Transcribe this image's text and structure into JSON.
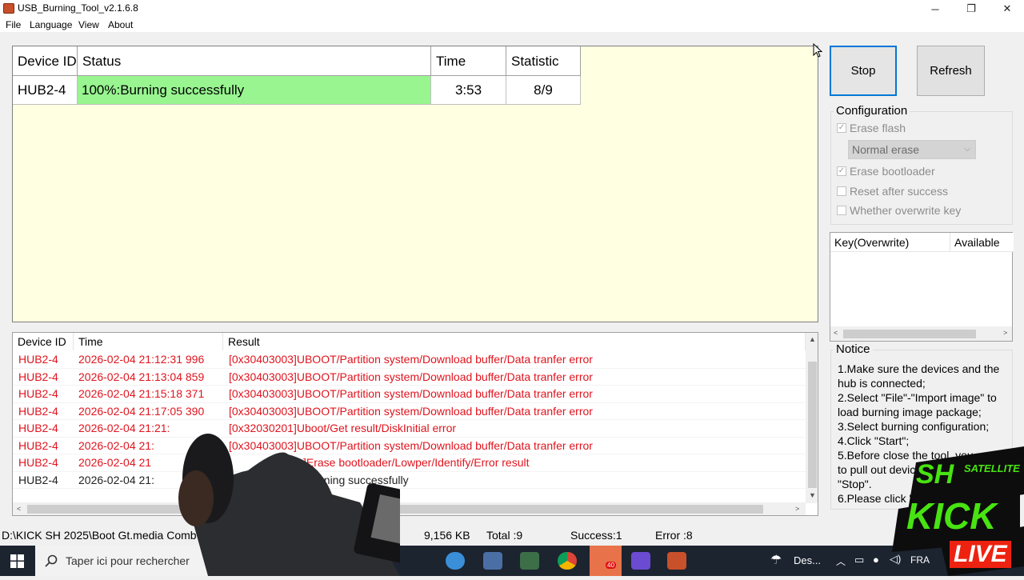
{
  "window": {
    "title": "USB_Burning_Tool_v2.1.6.8",
    "controls": {
      "minimize": "─",
      "maximize": "❐",
      "close": "✕"
    }
  },
  "menu": [
    "File",
    "Language",
    "View",
    "About"
  ],
  "device_grid": {
    "columns": [
      "Device ID",
      "Status",
      "Time",
      "Statistic"
    ],
    "rows": [
      {
        "device": "HUB2-4",
        "status": "100%:Burning successfully",
        "time": "3:53",
        "statistic": "8/9"
      }
    ],
    "status_color": "#98f590",
    "background": "#ffffe1"
  },
  "buttons": {
    "stop": "Stop",
    "refresh": "Refresh"
  },
  "configuration": {
    "title": "Configuration",
    "erase_flash": {
      "label": "Erase flash",
      "checked": true
    },
    "erase_mode": "Normal erase",
    "erase_bootloader": {
      "label": "Erase bootloader",
      "checked": true
    },
    "reset_after_success": {
      "label": "Reset after success",
      "checked": false
    },
    "overwrite_key": {
      "label": "Whether overwrite key",
      "checked": false
    }
  },
  "key_table": {
    "columns": [
      "Key(Overwrite)",
      "Available"
    ]
  },
  "notice": {
    "title": "Notice",
    "lines": [
      "1.Make sure the devices and the hub is connected;",
      "2.Select \"File\"-\"Import image\" to load burning image package;",
      "3.Select burning configuration;",
      "4.Click \"Start\";",
      "5.Before close the tool, you need to pull out devices first and click \"Stop\".",
      "6.Please click \"Stop\" before you"
    ]
  },
  "log": {
    "columns": [
      "Device ID",
      "Time",
      "Result"
    ],
    "rows": [
      {
        "device": "HUB2-4",
        "time": "2026-02-04 21:12:31 996",
        "result": "[0x30403003]UBOOT/Partition system/Download buffer/Data tranfer error",
        "kind": "err"
      },
      {
        "device": "HUB2-4",
        "time": "2026-02-04 21:13:04 859",
        "result": "[0x30403003]UBOOT/Partition system/Download buffer/Data tranfer error",
        "kind": "err"
      },
      {
        "device": "HUB2-4",
        "time": "2026-02-04 21:15:18 371",
        "result": "[0x30403003]UBOOT/Partition system/Download buffer/Data tranfer error",
        "kind": "err"
      },
      {
        "device": "HUB2-4",
        "time": "2026-02-04 21:17:05 390",
        "result": "[0x30403003]UBOOT/Partition system/Download buffer/Data tranfer error",
        "kind": "err"
      },
      {
        "device": "HUB2-4",
        "time": "2026-02-04 21:21:",
        "result": "[0x32030201]Uboot/Get result/DiskInitial error",
        "kind": "err"
      },
      {
        "device": "HUB2-4",
        "time": "2026-02-04 21:",
        "result": "[0x30403003]UBOOT/Partition system/Download buffer/Data tranfer error",
        "kind": "err"
      },
      {
        "device": "HUB2-4",
        "time": "2026-02-04 21",
        "result": "]Erase bootloader/Lowper/Identify/Error result",
        "kind": "err"
      },
      {
        "device": "HUB2-4",
        "time": "2026-02-04 21:",
        "result": "Burning successfully",
        "kind": "ok"
      }
    ],
    "error_color": "#e0141e"
  },
  "statusbar": {
    "path": "D:\\KICK SH 2025\\Boot Gt.media Comb",
    "size": "9,156 KB",
    "total": "Total :9",
    "success": "Success:1",
    "error": "Error :8"
  },
  "taskbar": {
    "search_placeholder": "Taper ici pour rechercher",
    "weather": "Des...",
    "language": "FRA",
    "badge": "40"
  },
  "watermark": {
    "line1": "SH",
    "line2": "SATELLITE",
    "line3": "KICK",
    "line4": "LIVE"
  }
}
